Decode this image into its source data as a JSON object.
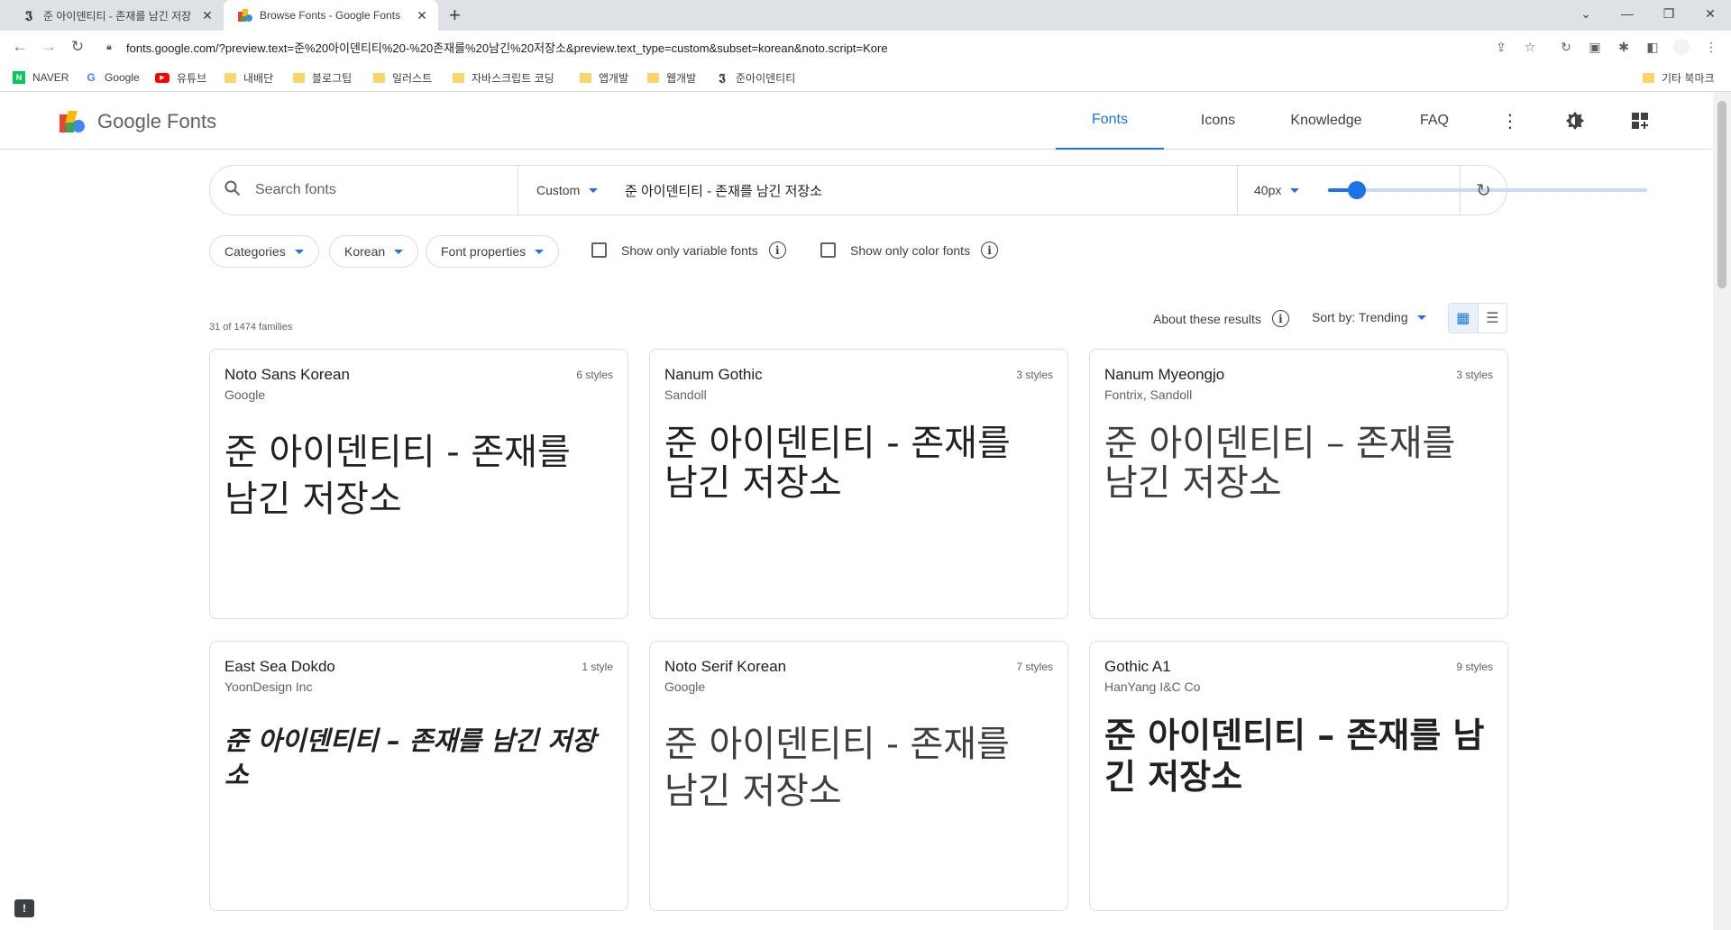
{
  "browser": {
    "tabs": [
      {
        "title": "준 아이덴티티 - 존재를 남긴 저장",
        "favicon": "letter-j-icon"
      },
      {
        "title": "Browse Fonts - Google Fonts",
        "favicon": "google-fonts-icon"
      }
    ],
    "url": "fonts.google.com/?preview.text=준%20아이덴티티%20-%20존재를%20남긴%20저장소&preview.text_type=custom&subset=korean&noto.script=Kore",
    "bookmarks": [
      {
        "label": "NAVER",
        "icon": "naver-icon"
      },
      {
        "label": "Google",
        "icon": "google-icon"
      },
      {
        "label": "유튜브",
        "icon": "youtube-icon"
      },
      {
        "label": "내배단",
        "icon": "folder-icon"
      },
      {
        "label": "블로그팁",
        "icon": "folder-icon"
      },
      {
        "label": "일러스트",
        "icon": "folder-icon"
      },
      {
        "label": "자바스크립트 코딩",
        "icon": "folder-icon"
      },
      {
        "label": "앱개발",
        "icon": "folder-icon"
      },
      {
        "label": "웹개발",
        "icon": "folder-icon"
      },
      {
        "label": "준아이덴티티",
        "icon": "letter-j-icon"
      }
    ],
    "other_bookmarks": "기타 북마크"
  },
  "header": {
    "brand": "Google Fonts",
    "nav": [
      {
        "label": "Fonts",
        "active": true
      },
      {
        "label": "Icons",
        "active": false
      },
      {
        "label": "Knowledge",
        "active": false
      },
      {
        "label": "FAQ",
        "active": false
      }
    ]
  },
  "search": {
    "placeholder": "Search fonts",
    "type_label": "Custom",
    "preview_text": "준 아이덴티티 - 존재를 남긴 저장소",
    "size_label": "40px",
    "size_fraction": 0.09
  },
  "filters": {
    "chips": [
      "Categories",
      "Korean",
      "Font properties"
    ],
    "checkboxes": [
      {
        "label": "Show only variable fonts",
        "checked": false
      },
      {
        "label": "Show only color fonts",
        "checked": false
      }
    ]
  },
  "results": {
    "count": "31 of 1474 families",
    "about": "About these results",
    "sort": "Sort by: Trending"
  },
  "cards": [
    {
      "name": "Noto Sans Korean",
      "author": "Google",
      "styles": "6 styles",
      "preview": "준 아이덴티티 - 존재를 남긴 저장소"
    },
    {
      "name": "Nanum Gothic",
      "author": "Sandoll",
      "styles": "3 styles",
      "preview": "준 아이덴티티 - 존재를 남긴 저장소"
    },
    {
      "name": "Nanum Myeongjo",
      "author": "Fontrix, Sandoll",
      "styles": "3 styles",
      "preview": "준 아이덴티티 – 존재를 남긴 저장소"
    },
    {
      "name": "East Sea Dokdo",
      "author": "YoonDesign Inc",
      "styles": "1 style",
      "preview": "준 아이덴티티 – 존재를 남긴 저장소"
    },
    {
      "name": "Noto Serif Korean",
      "author": "Google",
      "styles": "7 styles",
      "preview": "준 아이덴티티 - 존재를 남긴 저장소"
    },
    {
      "name": "Gothic A1",
      "author": "HanYang I&C Co",
      "styles": "9 styles",
      "preview": "준 아이덴티티 – 존재를 남긴 저장소"
    }
  ],
  "colors": {
    "accent": "#1a73e8",
    "border": "#dadce0",
    "text": "#202124",
    "muted": "#5f6368"
  }
}
